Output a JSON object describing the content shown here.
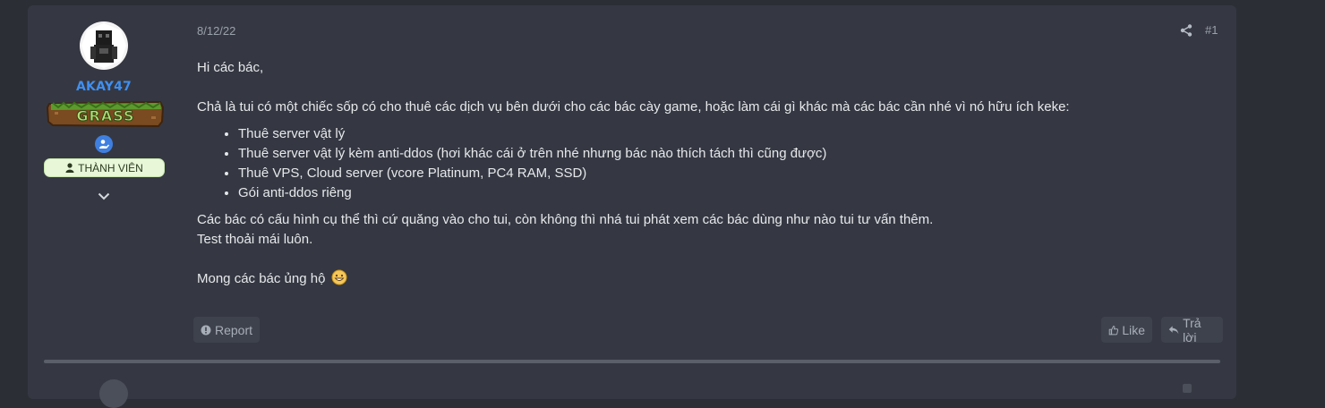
{
  "user": {
    "name": "AKAY47",
    "rank_banner_text": "GRASS",
    "role": "THÀNH VIÊN",
    "verified_icon": "user-check-icon",
    "expand_icon": "chevron-down-icon"
  },
  "post": {
    "date": "8/12/22",
    "number": "#1",
    "greeting": "Hi các bác,",
    "intro": "Chả là tui có một chiếc sốp có cho thuê các dịch vụ bên dưới cho các bác cày game, hoặc làm cái gì khác mà các bác cần nhé vì nó hữu ích keke:",
    "services": [
      "Thuê server vật lý",
      "Thuê server vật lý kèm anti-ddos (hơi khác cái ở trên nhé nhưng bác nào thích tách thì cũng được)",
      "Thuê VPS, Cloud server (vcore Platinum, PC4 RAM, SSD)",
      "Gói anti-ddos riêng"
    ],
    "paragraph_1": "Các bác có cấu hình cụ thể thì cứ quăng vào cho tui, còn không thì nhá tui phát xem các bác dùng như nào tui tư vấn thêm.",
    "paragraph_2": "Test thoải mái luôn.",
    "closing": "Mong các bác ủng hộ",
    "closing_emoji": "grinning-face-icon"
  },
  "actions": {
    "report_label": "Report",
    "like_label": "Like",
    "reply_label": "Trả lời"
  },
  "colors": {
    "background": "#2b2e35",
    "card": "#353842",
    "username": "#3f8ff0",
    "role_badge_bg": "#e7f7d8"
  }
}
